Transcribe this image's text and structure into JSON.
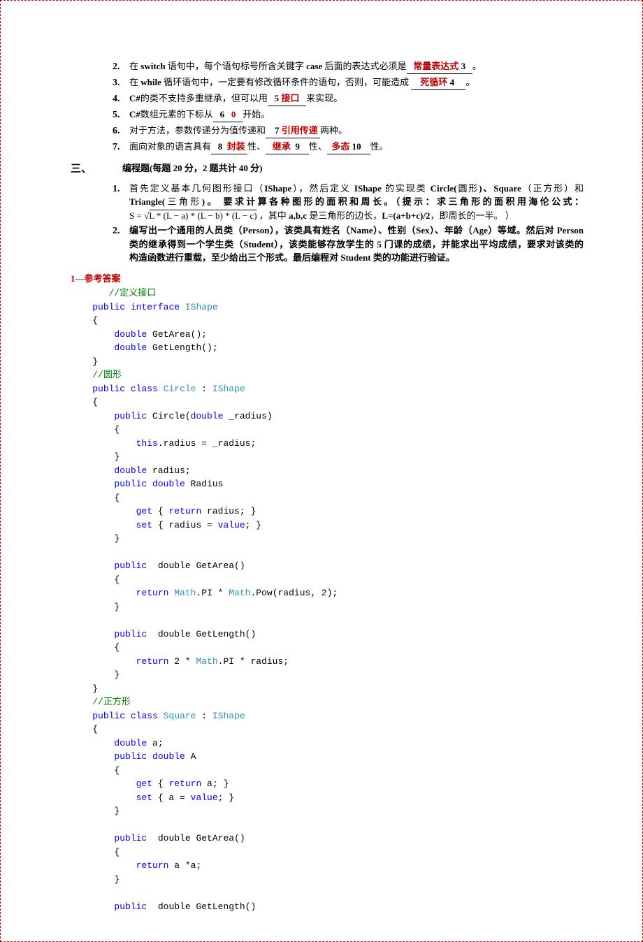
{
  "fill": {
    "q2": {
      "num": "2.",
      "pre": "在 ",
      "kw1": "switch",
      "mid1": " 语句中，每个语句标号所含关键字 ",
      "kw2": "case",
      "mid2": " 后面的表达式必须是",
      "ans": "常量表达式",
      "idx": "3",
      "end": "。"
    },
    "q3": {
      "num": "3.",
      "pre": "在 ",
      "kw1": "while",
      "mid1": " 循环语句中，一定要有修改循环条件的语句，否则，可能造成 ",
      "ans": "死循环",
      "idx": "4",
      "end": "。"
    },
    "q4": {
      "num": "4.",
      "kw1": "C#",
      "mid1": "的类不支持多重继承，但可以用",
      "idx": "5",
      "ans": "接口",
      "end": "来实现。"
    },
    "q5": {
      "num": "5.",
      "kw1": "C#",
      "mid1": "数组元素的下标从",
      "idx": "6",
      "ans": "0",
      "end": "开始。"
    },
    "q6": {
      "num": "6.",
      "mid1": "对于方法，参数传递分为值传递和",
      "idx": "7",
      "ans": "引用传递",
      "end": "两种。"
    },
    "q7": {
      "num": "7.",
      "mid1": "面向对象的语言具有",
      "idx1": "8",
      "ans1": "封装",
      "lbl1": "性、",
      "idx2": "9",
      "ans2": "继承",
      "lbl2": "性、",
      "idx3": "10",
      "ans3": "多态",
      "lbl3": "性。"
    }
  },
  "section3": {
    "label": "三、",
    "title": "编程题(每题 20 分，2 题共计 40 分)",
    "p1": {
      "num": "1.",
      "l1a": "首先定义基本几何图形接口（",
      "l1b": "IShape",
      "l1c": "），然后定义 ",
      "l1d": "IShape",
      "l1e": " 的实现类 ",
      "l1f": "Circle(",
      "l1g": "圆形",
      "l1h": ")、Square",
      "l1i": "（正方形）和",
      "l2a": "Triangle(",
      "l2b": "三角形",
      "l2c": ")。 要求计算各种图形的面积和周长。（提示：求三角形的面积用海伦公式：",
      "formula_S": "S = ",
      "formula_body": "L * (L − a) * (L − b) * (L − c)",
      "formula_tail1": " ，其中 ",
      "formula_tail2": "a,b,c",
      "formula_tail3": " 是三角形的边长，",
      "formula_tail4": "L=(a+b+c)/2",
      "formula_tail5": "，即周长的一半。 ）"
    },
    "p2": {
      "num": "2.",
      "l1": "编写出一个通用的人员类（Person），该类具有姓名（Name）、性别（Sex）、年龄（Age）等域。然后对 Person",
      "l2": "类的继承得到一个学生类（Student），该类能够存放学生的 5 门课的成绩，并能求出平均成绩，要求对该类的",
      "l3": "构造函数进行重载，至少给出三个形式。最后编程对 Student 类的功能进行验证。"
    }
  },
  "answer_header": "1---参考答案",
  "code": {
    "cm1": "//定义接口",
    "pub": "public",
    "intf": "interface",
    "cls": "class",
    "dbl": "double",
    "ret": "return",
    "get": "get",
    "set": "set",
    "val": "value",
    "this": "this",
    "IShape": "IShape",
    "Circle": "Circle",
    "Square": "Square",
    "Math": "Math",
    "GetArea": " GetArea();",
    "GetLength": " GetLength();",
    "cm_circle": "//圆形",
    "cm_square": "//正方形",
    "circle_sig": " Circle(",
    "radius_p": " _radius)",
    "radius_asn": ".radius = _radius;",
    "radius_fld": " radius;",
    "Radius": " Radius",
    "ret_radius": " radius; }",
    "set_radius": " { radius = ",
    "val_end": "; }",
    "GetAreaSig": "  double GetArea()",
    "GetLengthSig": "  double GetLength()",
    "ret_pi_pow": ".PI * ",
    "pow_call": ".Pow(radius, 2);",
    "ret_2pi": " 2 * ",
    "pi_r": ".PI * radius;",
    "a_fld": " a;",
    "A": " A",
    "ret_a": " a; }",
    "set_a": " { a = ",
    "ret_aa": " a *a;"
  }
}
